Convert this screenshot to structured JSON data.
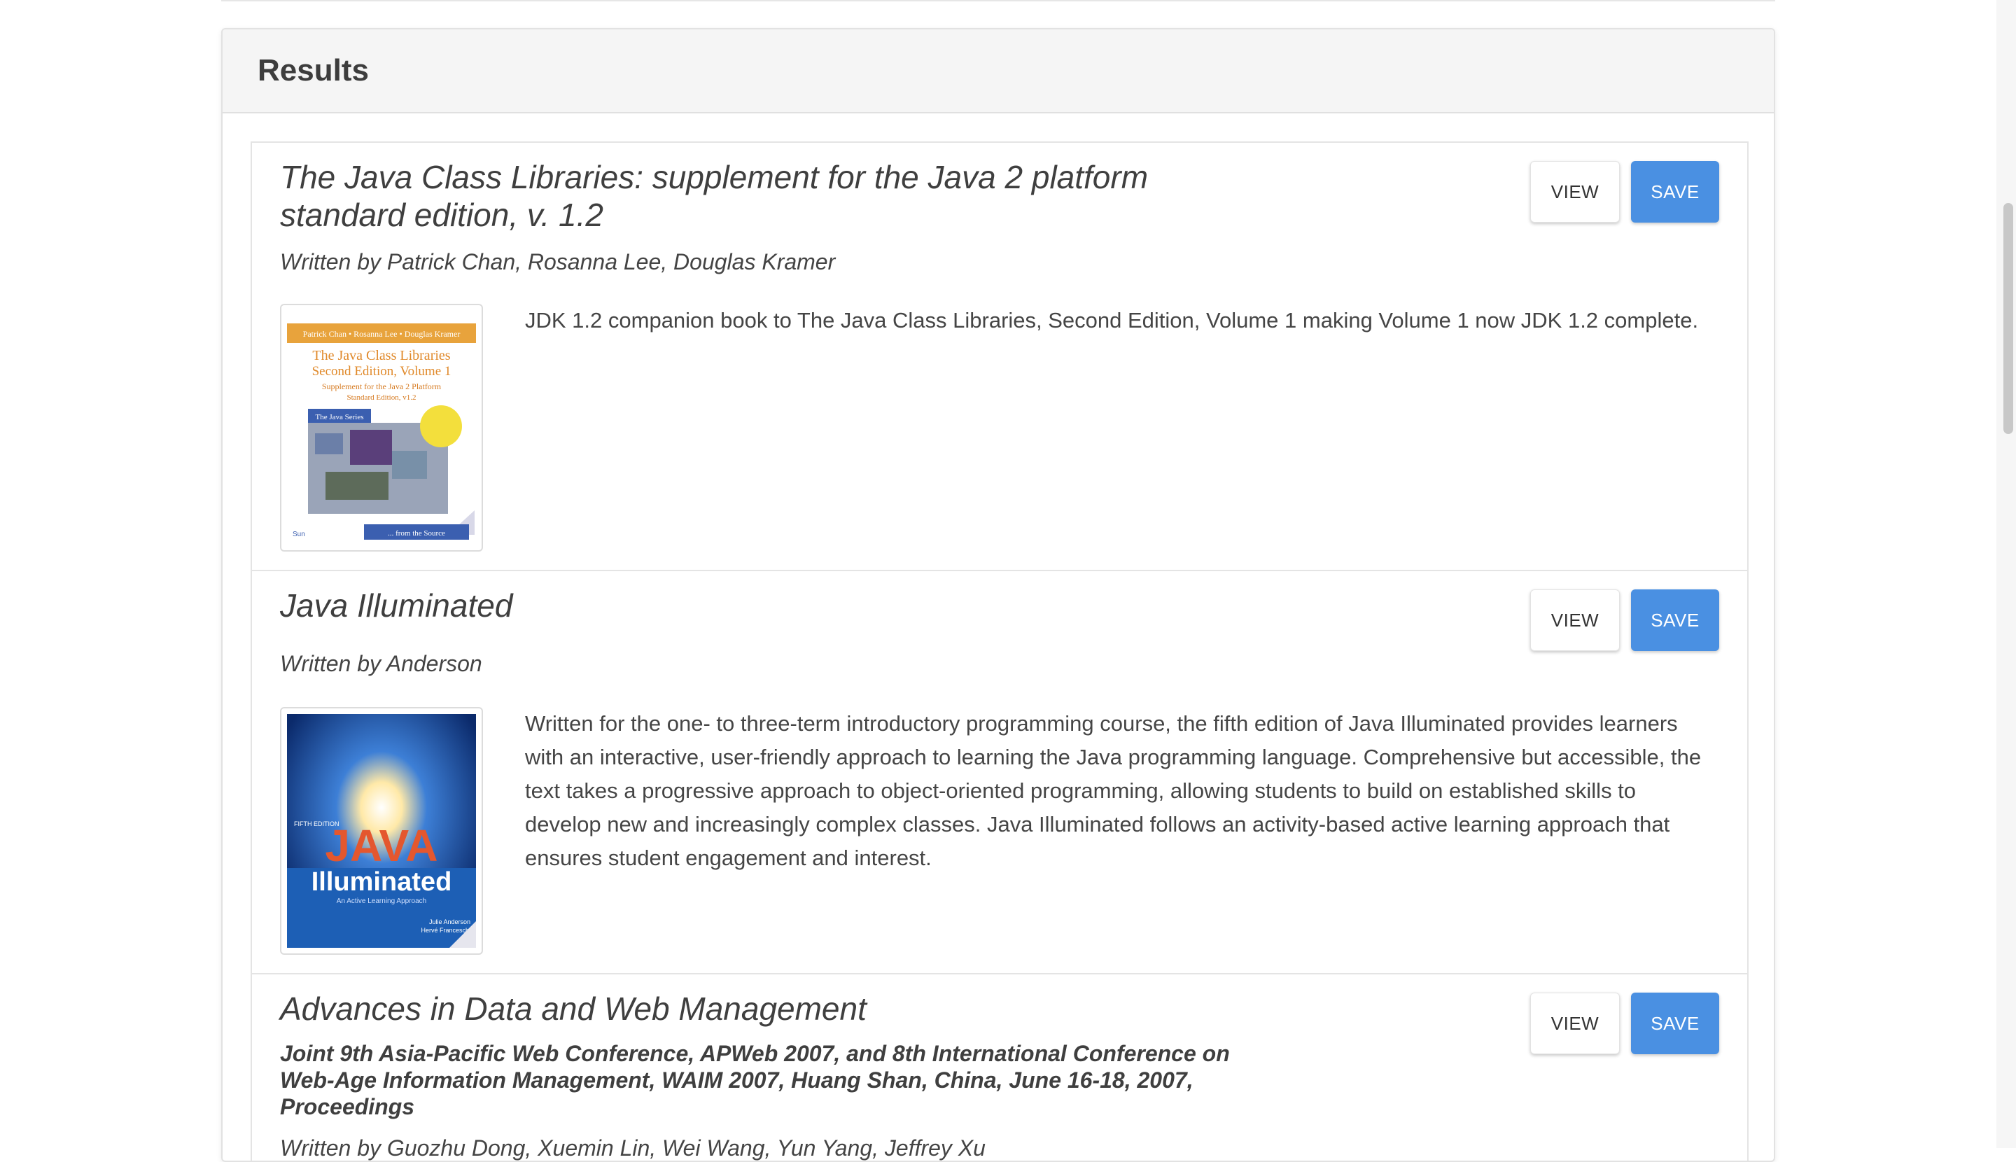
{
  "panel": {
    "title": "Results"
  },
  "buttons": {
    "view": "VIEW",
    "save": "SAVE"
  },
  "results": [
    {
      "title_line1": "The Java Class Libraries: supplement for the Java 2 platform",
      "title_line2": "standard edition, v. 1.2",
      "authors": "Written by Patrick Chan, Rosanna Lee, Douglas Kramer",
      "description": "JDK 1.2 companion book to The Java Class Libraries, Second Edition, Volume 1 making Volume 1 now JDK 1.2 complete.",
      "cover": {
        "authors": "Patrick Chan • Rosanna Lee • Douglas Kramer",
        "title": "The Java Class Libraries",
        "edition": "Second Edition, Volume 1",
        "sub1": "Supplement for the Java 2 Platform",
        "sub2": "Standard Edition, v1.2",
        "series": "The Java Series",
        "tagline": "... from the Source",
        "publisher": "Sun"
      }
    },
    {
      "title": "Java Illuminated",
      "authors": "Written by Anderson",
      "description": "Written for the one- to three-term introductory programming course, the fifth edition of Java Illuminated provides learners with an interactive, user-friendly approach to learning the Java programming language. Comprehensive but accessible, the text takes a progressive approach to object-oriented programming, allowing students to build on established skills to develop new and increasingly complex classes. Java Illuminated follows an activity-based active learning approach that ensures student engagement and interest.",
      "cover": {
        "edition": "FIFTH EDITION",
        "word1": "JAVA",
        "word2": "Illuminated",
        "tagline": "An Active Learning Approach",
        "author1": "Julie Anderson",
        "author2": "Hervé Franceschi"
      }
    },
    {
      "title": "Advances in Data and Web Management",
      "subtitle": "Joint 9th Asia-Pacific Web Conference, APWeb 2007, and 8th International Conference on Web-Age Information Management, WAIM 2007, Huang Shan, China, June 16-18, 2007, Proceedings",
      "authors": "Written by Guozhu Dong, Xuemin Lin, Wei Wang, Yun Yang, Jeffrey Xu"
    }
  ],
  "colors": {
    "save_button": "#4a90e2",
    "header_bg": "#f5f5f5"
  }
}
